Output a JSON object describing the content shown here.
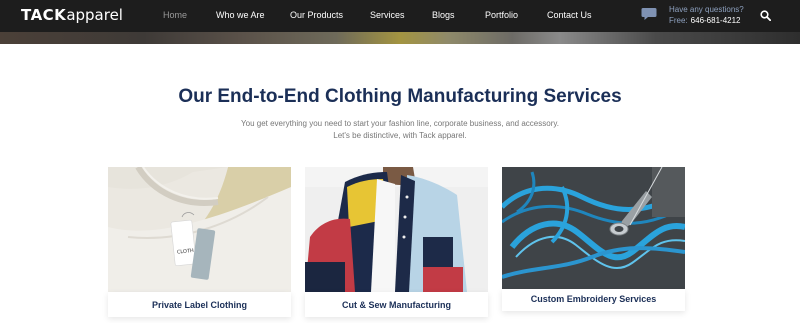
{
  "header": {
    "logo_strong": "TACK",
    "logo_light": "apparel",
    "nav": [
      {
        "label": "Home",
        "active": true
      },
      {
        "label": "Who we Are",
        "active": false
      },
      {
        "label": "Our Products",
        "active": false
      },
      {
        "label": "Services",
        "active": false
      },
      {
        "label": "Blogs",
        "active": false
      },
      {
        "label": "Portfolio",
        "active": false
      },
      {
        "label": "Contact Us",
        "active": false
      }
    ],
    "contact_question": "Have any questions?",
    "contact_phone_label": "Free:",
    "contact_phone": "646-681-4212",
    "icons": {
      "chat": "chat-bubble-icon",
      "search": "search-icon"
    }
  },
  "section": {
    "title": "Our End-to-End Clothing Manufacturing Services",
    "subtitle_line1": "You get everything you need to start your fashion line, corporate business, and accessory.",
    "subtitle_line2": "Let's be distinctive, with Tack apparel."
  },
  "cards": [
    {
      "title": "Private Label Clothing"
    },
    {
      "title": "Cut & Sew Manufacturing"
    },
    {
      "title": "Custom Embroidery Services"
    }
  ],
  "colors": {
    "header_bg": "#1d1d1d",
    "title_navy": "#1b2f57",
    "muted_blue": "#8ea1bf",
    "embroidery_blue": "#2aa3dc"
  }
}
